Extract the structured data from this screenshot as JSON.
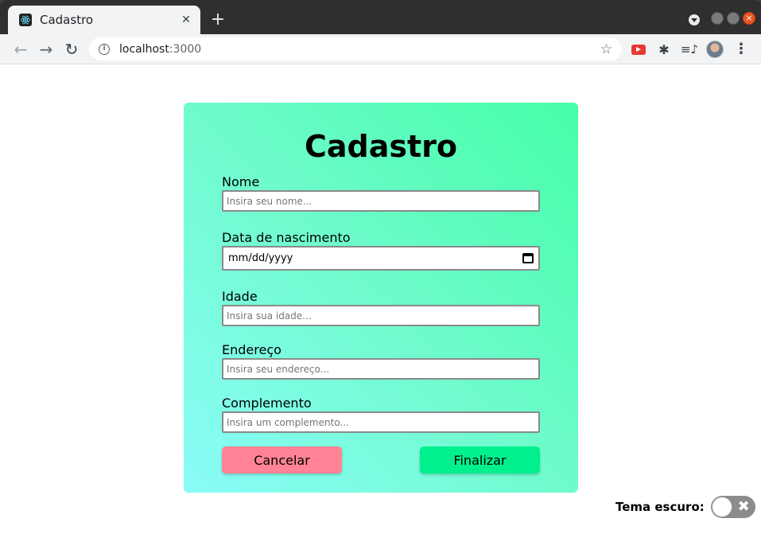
{
  "browser": {
    "tab_title": "Cadastro",
    "new_tab_label": "+",
    "url_host": "localhost",
    "url_port": ":3000"
  },
  "form": {
    "title": "Cadastro",
    "fields": {
      "nome": {
        "label": "Nome",
        "placeholder": "Insira seu nome..."
      },
      "nascimento": {
        "label": "Data de nascimento",
        "value": "mm/dd/yyyy"
      },
      "idade": {
        "label": "Idade",
        "placeholder": "Insira sua idade..."
      },
      "endereco": {
        "label": "Endereço",
        "placeholder": "Insira seu endereço..."
      },
      "complemento": {
        "label": "Complemento",
        "placeholder": "Insira um complemento..."
      }
    },
    "cancel_label": "Cancelar",
    "submit_label": "Finalizar"
  },
  "theme": {
    "label": "Tema escuro:",
    "dark_enabled": false
  },
  "colors": {
    "card_gradient_start": "#45fea8",
    "card_gradient_end": "#8afcf8",
    "cancel": "#ff8394",
    "submit": "#00f08d"
  }
}
